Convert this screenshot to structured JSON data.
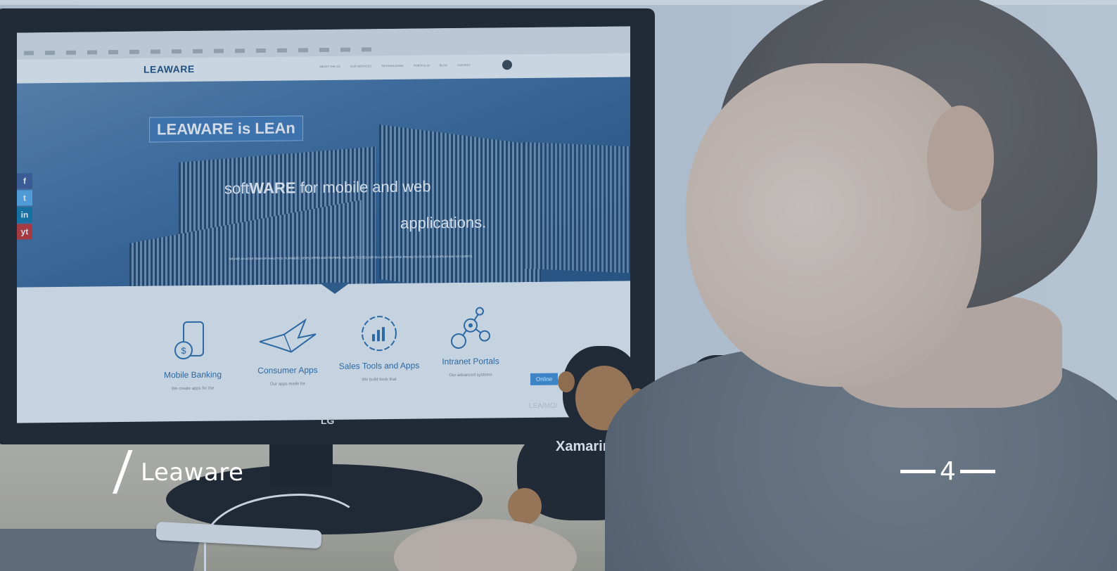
{
  "website": {
    "logo": "LEAWARE",
    "nav": [
      "ABOUT THE CO",
      "OUR SERVICES",
      "TECHNOLOGIES",
      "PORTFOLIO",
      "BLOG",
      "CONTACT"
    ],
    "hero": {
      "badge": "LEAWARE is LEAn",
      "title_prefix": "soft",
      "title_bold": "WARE",
      "title_suffix": " for mobile and web",
      "title_line2": "applications.",
      "small_text": "WE ARE AN AGILE TEAM OF ANALYTICS, PLANNERS, DEVELOPERS AND TESTERS. WE HAVE TESTED OUR SKILLS IN MULTIPLE PROJECTS FOR OUR EUROPEAN AND US CLIENTS."
    },
    "social": [
      "f",
      "t",
      "in",
      "yt"
    ],
    "services": [
      {
        "icon": "mobile-banking-icon",
        "label": "Mobile Banking",
        "desc": "We create apps for the"
      },
      {
        "icon": "consumer-apps-icon",
        "label": "Consumer Apps",
        "desc": "Our apps made for"
      },
      {
        "icon": "sales-tools-icon",
        "label": "Sales Tools and Apps",
        "desc": "We build tools that"
      },
      {
        "icon": "intranet-portals-icon",
        "label": "Intranet Portals",
        "desc": "Our advanced systems"
      }
    ],
    "online_button": "Online"
  },
  "monitor": {
    "brand": "LG",
    "model": "LEA/MO/"
  },
  "plush_text": "Xamarin",
  "overlay": {
    "brand": "Leaware",
    "page_number": "4"
  }
}
